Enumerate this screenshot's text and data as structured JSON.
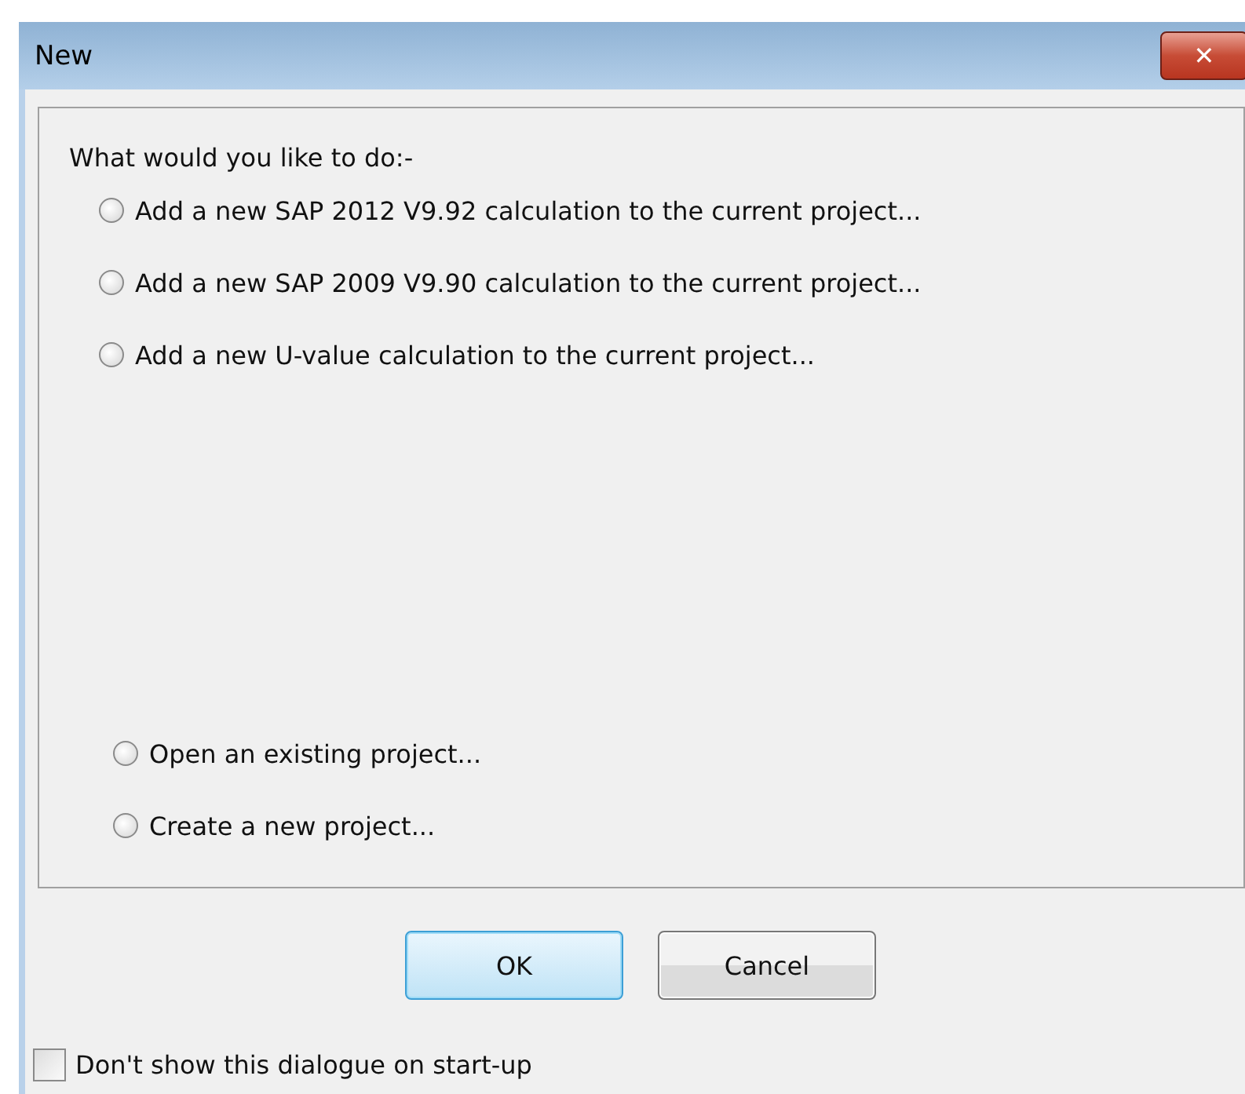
{
  "window": {
    "title": "New",
    "close_label": "✕"
  },
  "prompt": "What would you like to do:-",
  "calculation_options": [
    {
      "label": "Add a new SAP 2012 V9.92 calculation to the current project...",
      "selected": false
    },
    {
      "label": "Add a new SAP 2009 V9.90 calculation to the current project...",
      "selected": false
    },
    {
      "label": "Add a new U-value calculation to the current project...",
      "selected": false
    }
  ],
  "project_options": [
    {
      "label": "Open an existing project...",
      "selected": false
    },
    {
      "label": "Create a new project...",
      "selected": false
    }
  ],
  "buttons": [
    {
      "label": "OK",
      "default": true
    },
    {
      "label": "Cancel",
      "default": false
    }
  ],
  "startup_checkbox": {
    "label": "Don't show this dialogue on start-up",
    "checked": false
  }
}
